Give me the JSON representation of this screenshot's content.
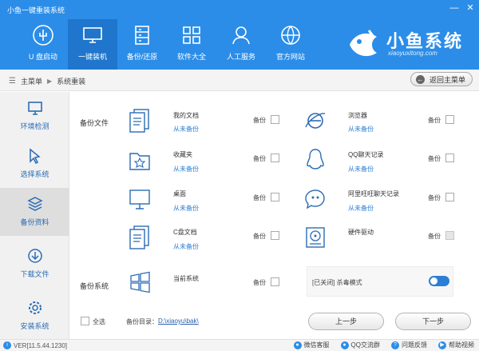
{
  "window": {
    "title": "小鱼一键重装系统",
    "min_icon": "minimize-icon",
    "close_icon": "close-icon"
  },
  "nav": [
    {
      "label": "U 盘启动",
      "icon": "usb-icon"
    },
    {
      "label": "一键装机",
      "icon": "monitor-icon",
      "active": true
    },
    {
      "label": "备份/还原",
      "icon": "database-icon"
    },
    {
      "label": "软件大全",
      "icon": "grid-icon"
    },
    {
      "label": "人工服务",
      "icon": "person-icon"
    },
    {
      "label": "官方网站",
      "icon": "globe-icon"
    }
  ],
  "brand": {
    "name": "小鱼系统",
    "url": "xiaoyuxitong.com"
  },
  "breadcrumb": {
    "home": "主菜单",
    "current": "系统重装"
  },
  "back_button": "返回主菜单",
  "sidebar": [
    {
      "label": "环境检测",
      "icon": "monitor-check-icon"
    },
    {
      "label": "选择系统",
      "icon": "cursor-icon"
    },
    {
      "label": "备份资料",
      "icon": "layers-icon",
      "active": true
    },
    {
      "label": "下载文件",
      "icon": "download-icon"
    },
    {
      "label": "安装系统",
      "icon": "settings-icon"
    }
  ],
  "sections": {
    "backup_files": "备份文件",
    "backup_system": "备份系统"
  },
  "backup_label": "备份",
  "left_items": [
    {
      "name": "我的文档",
      "status": "从未备份"
    },
    {
      "name": "收藏夹",
      "status": "从未备份"
    },
    {
      "name": "桌面",
      "status": "从未备份"
    },
    {
      "name": "C盘文档",
      "status": "从未备份"
    }
  ],
  "right_items": [
    {
      "name": "浏览器",
      "status": "从未备份"
    },
    {
      "name": "QQ聊天记录",
      "status": "从未备份"
    },
    {
      "name": "阿里旺旺聊天记录",
      "status": "从未备份"
    },
    {
      "name": "硬件驱动",
      "status": ""
    }
  ],
  "system_item": {
    "name": "当前系统"
  },
  "antivirus": {
    "text": "[已关闭] 杀毒模式",
    "enabled": true
  },
  "select_all": "全选",
  "backup_dir": {
    "label": "备份目录：",
    "path": "D:\\xiaoyu\\bak\\"
  },
  "buttons": {
    "prev": "上一步",
    "next": "下一步"
  },
  "footer": {
    "version": "VER[11.5.44.1230]",
    "links": [
      "微信客服",
      "QQ交流群",
      "问题反馈",
      "帮助视频"
    ]
  },
  "colors": {
    "primary": "#2b8de8",
    "accent": "#2b7fd4"
  }
}
